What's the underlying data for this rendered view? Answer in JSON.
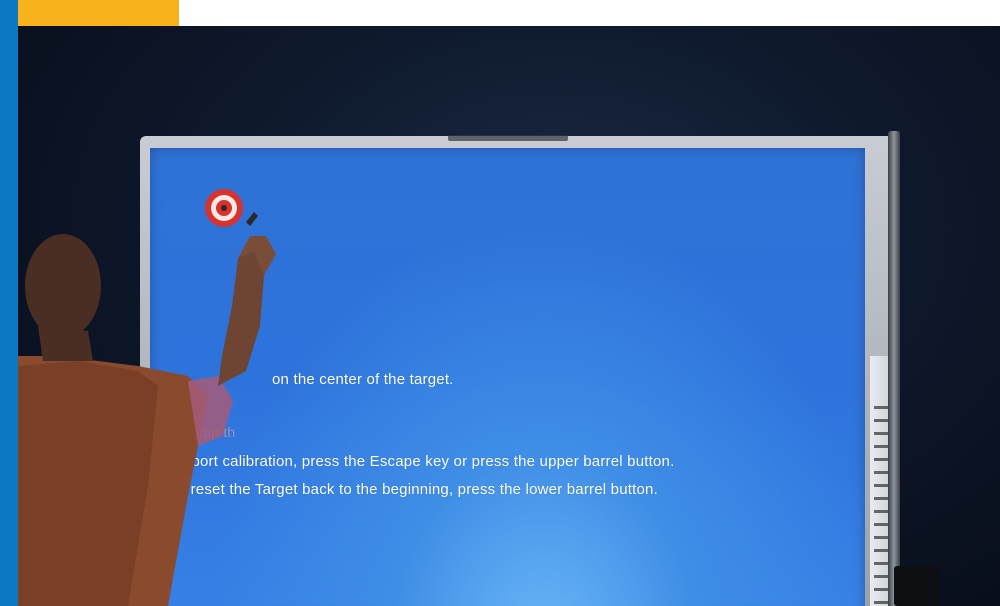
{
  "instructions": {
    "line1": "on the center of the target.",
    "tap_partial": "Tap th",
    "line2": "o abort calibration, press the Escape key or press the upper barrel button.",
    "line3": "To reset the Target back to the beginning, press the lower barrel button."
  },
  "icons": {
    "calibration_target": "bullseye-target-icon"
  },
  "colors": {
    "left_bar": "#0b78c5",
    "top_tab": "#f8b21c",
    "screen_blue": "#2e73dc",
    "target_red": "#d9322b"
  }
}
